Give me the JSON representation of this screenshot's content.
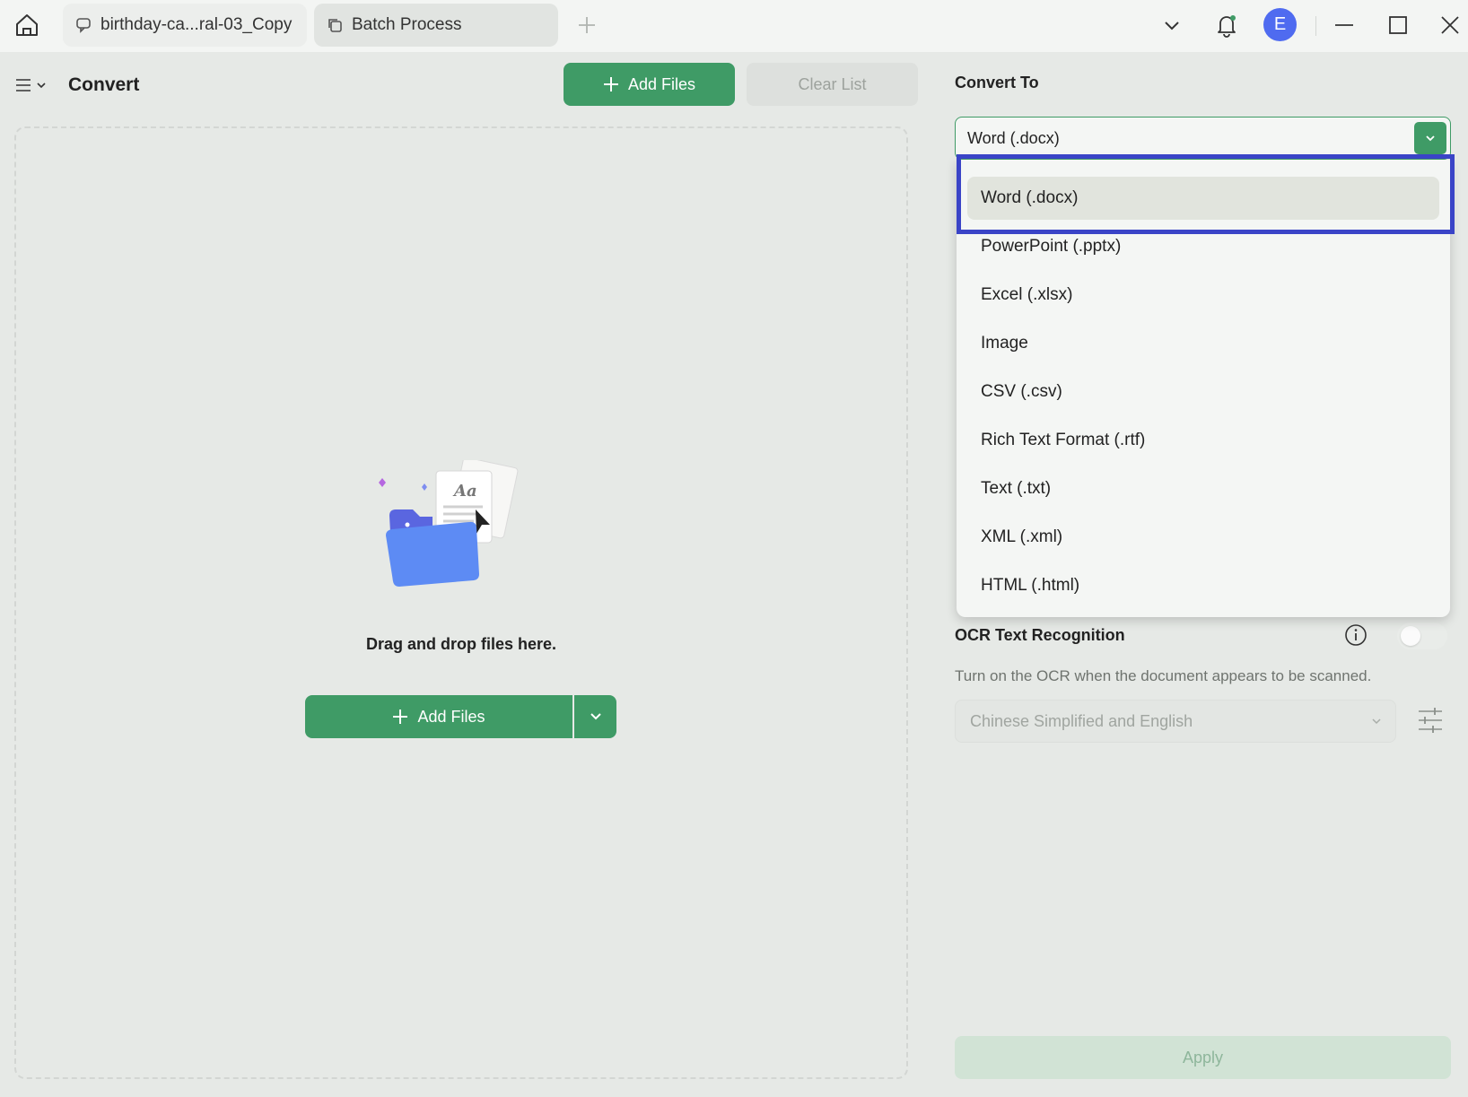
{
  "titlebar": {
    "tabs": [
      {
        "label": "birthday-ca...ral-03_Copy",
        "icon": "comment-icon"
      },
      {
        "label": "Batch Process",
        "icon": "copy-icon"
      }
    ],
    "avatar_initial": "E"
  },
  "left": {
    "page_title": "Convert",
    "add_files_label": "Add Files",
    "clear_list_label": "Clear List",
    "drop_text": "Drag and drop files here.",
    "main_add_files_label": "Add Files"
  },
  "right": {
    "convert_to_label": "Convert To",
    "selected_format": "Word (.docx)",
    "format_options": [
      "Word (.docx)",
      "PowerPoint (.pptx)",
      "Excel (.xlsx)",
      "Image",
      "CSV (.csv)",
      "Rich Text Format (.rtf)",
      "Text (.txt)",
      "XML (.xml)",
      "HTML (.html)"
    ],
    "ocr_label": "OCR Text Recognition",
    "ocr_enabled": false,
    "ocr_description": "Turn on the OCR when the document appears to be scanned.",
    "ocr_language": "Chinese Simplified and English",
    "apply_label": "Apply"
  },
  "colors": {
    "accent_green": "#3f9b66",
    "highlight_blue": "#3a44c7",
    "avatar_blue": "#4f6bf0"
  }
}
